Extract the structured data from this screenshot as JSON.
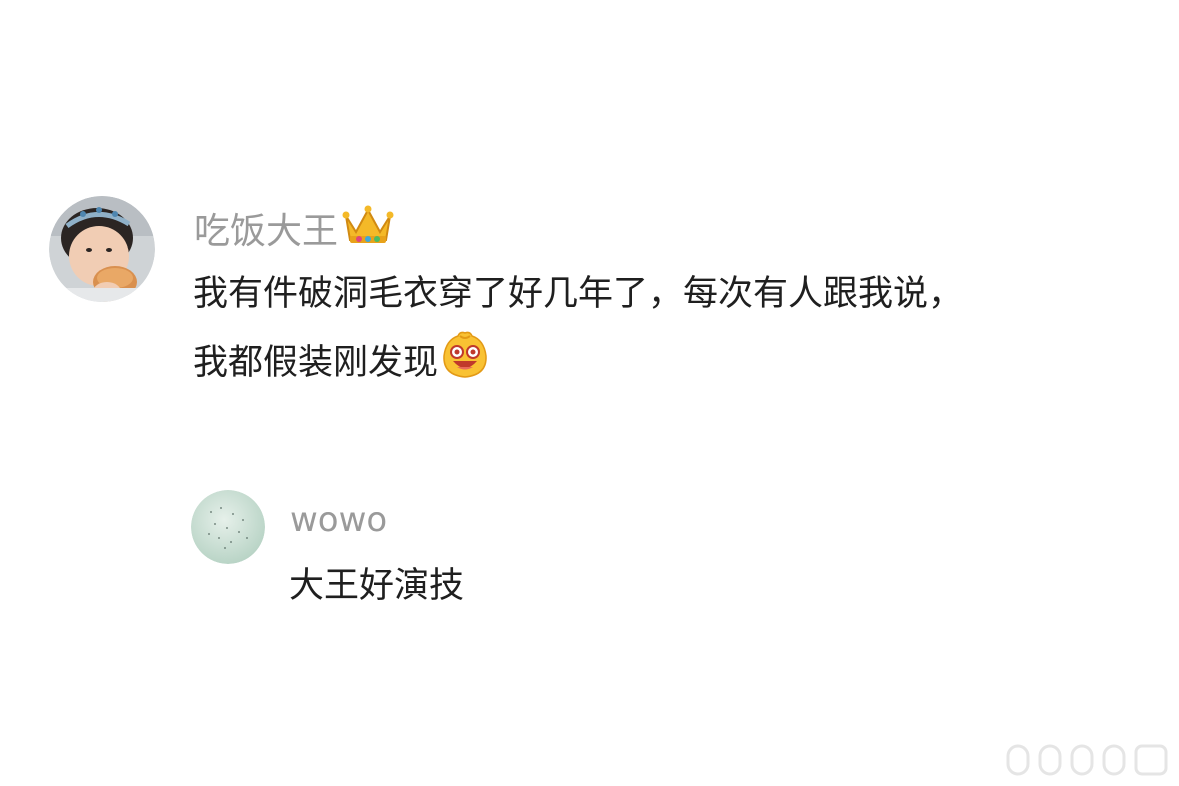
{
  "comment": {
    "username": "吃饭大王",
    "badge_icon": "crown-icon",
    "text_line1": "我有件破洞毛衣穿了好几年了，每次有人跟我说，",
    "text_line2": "我都假装刚发现",
    "trailing_emoji": "surprised-face-emoji"
  },
  "reply": {
    "username": "wowo",
    "text": "大王好演技"
  },
  "colors": {
    "username": "#9a9a9a",
    "body_text": "#1f1f1f",
    "background": "#ffffff"
  }
}
